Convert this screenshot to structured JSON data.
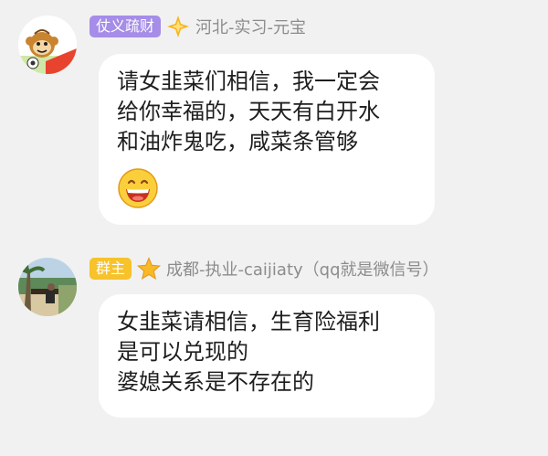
{
  "colors": {
    "background": "#f1f1f1",
    "bubble": "#ffffff",
    "badge_member": "#a58de8",
    "badge_owner": "#f7c22a",
    "nickname": "#8c8c8c"
  },
  "messages": [
    {
      "badge": "仗义疏财",
      "level_icon": "diamond-star-icon",
      "nickname": "河北-实习-元宝",
      "avatar": "cartoon-monkey-avatar",
      "lines": [
        "请女韭菜们相信，我一定会",
        "给你幸福的，天天有白开水",
        "和油炸鬼吃，咸菜条管够"
      ],
      "emoji": "grinning-face-emoji"
    },
    {
      "badge": "群主",
      "level_icon": "star-icon",
      "nickname": "成都-执业-caijiaty（qq就是微信号）",
      "avatar": "beach-photo-avatar",
      "lines": [
        "女韭菜请相信，生育险福利",
        "是可以兑现的",
        "婆媳关系是不存在的"
      ]
    }
  ]
}
